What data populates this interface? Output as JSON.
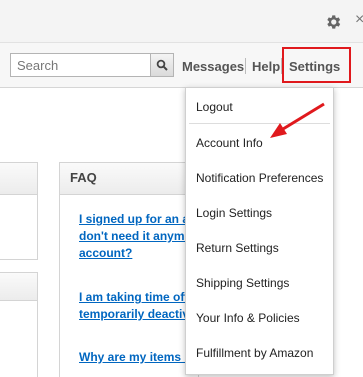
{
  "header": {
    "search_placeholder": "Search",
    "messages_label": "Messages",
    "help_label": "Help",
    "settings_label": "Settings"
  },
  "faq": {
    "title": "FAQ",
    "lines": [
      "I signed up for an a",
      "don't need it anymo",
      "account?",
      "I am taking time off",
      "temporarily deactiv",
      "Why are my items n"
    ]
  },
  "dropdown": {
    "items": [
      "Logout",
      "Account Info",
      "Notification Preferences",
      "Login Settings",
      "Return Settings",
      "Shipping Settings",
      "Your Info & Policies",
      "Fulfillment by Amazon"
    ]
  },
  "colors": {
    "highlight_red": "#e0191d",
    "link_blue": "#0066c0"
  },
  "icons": [
    "gear-icon",
    "close-icon",
    "search-icon",
    "arrow-annotation"
  ]
}
